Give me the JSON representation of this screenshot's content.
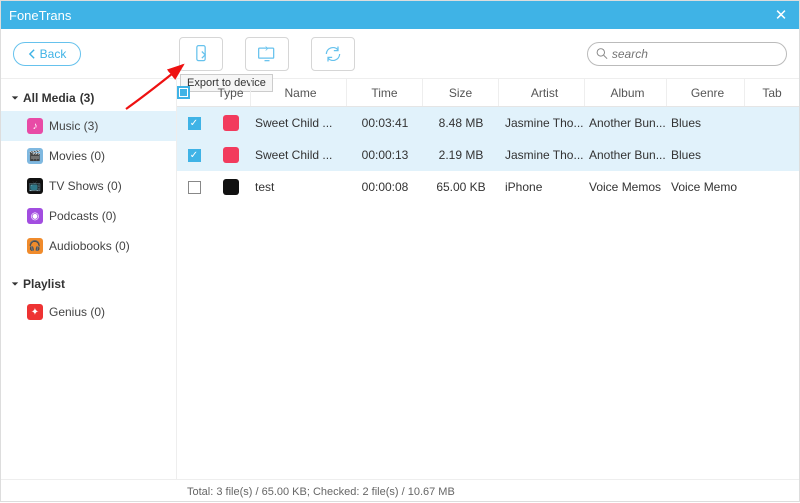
{
  "app": {
    "title": "FoneTrans"
  },
  "toolbar": {
    "back": "Back",
    "tooltip_export_device": "Export to device",
    "search_placeholder": "search"
  },
  "sidebar": {
    "all_media": {
      "label": "All Media",
      "count_suffix": "(3)"
    },
    "items": [
      {
        "label": "Music (3)",
        "icon_bg": "#e84ba6",
        "glyph": "♪",
        "selected": true
      },
      {
        "label": "Movies (0)",
        "icon_bg": "#7fb8e0",
        "glyph": "🎬",
        "selected": false
      },
      {
        "label": "TV Shows (0)",
        "icon_bg": "#111",
        "glyph": "📺",
        "selected": false
      },
      {
        "label": "Podcasts (0)",
        "icon_bg": "#a24de0",
        "glyph": "◉",
        "selected": false
      },
      {
        "label": "Audiobooks (0)",
        "icon_bg": "#f08b2c",
        "glyph": "🎧",
        "selected": false
      }
    ],
    "playlist": {
      "label": "Playlist"
    },
    "playlist_items": [
      {
        "label": "Genius (0)",
        "icon_bg": "#e33",
        "glyph": "✦"
      }
    ]
  },
  "table": {
    "columns": {
      "type": "Type",
      "name": "Name",
      "time": "Time",
      "size": "Size",
      "artist": "Artist",
      "album": "Album",
      "genre": "Genre",
      "tab": "Tab"
    },
    "rows": [
      {
        "checked": true,
        "icon_bg": "#f23b5d",
        "name": "Sweet Child ...",
        "time": "00:03:41",
        "size": "8.48 MB",
        "artist": "Jasmine Tho...",
        "album": "Another Bun...",
        "genre": "Blues",
        "tab": ""
      },
      {
        "checked": true,
        "icon_bg": "#f23b5d",
        "name": "Sweet Child ...",
        "time": "00:00:13",
        "size": "2.19 MB",
        "artist": "Jasmine Tho...",
        "album": "Another Bun...",
        "genre": "Blues",
        "tab": ""
      },
      {
        "checked": false,
        "icon_bg": "#111",
        "name": "test",
        "time": "00:00:08",
        "size": "65.00 KB",
        "artist": "iPhone",
        "album": "Voice Memos",
        "genre": "Voice Memo",
        "tab": ""
      }
    ]
  },
  "footer": {
    "text": "Total: 3 file(s) / 65.00 KB; Checked: 2 file(s) / 10.67 MB"
  }
}
